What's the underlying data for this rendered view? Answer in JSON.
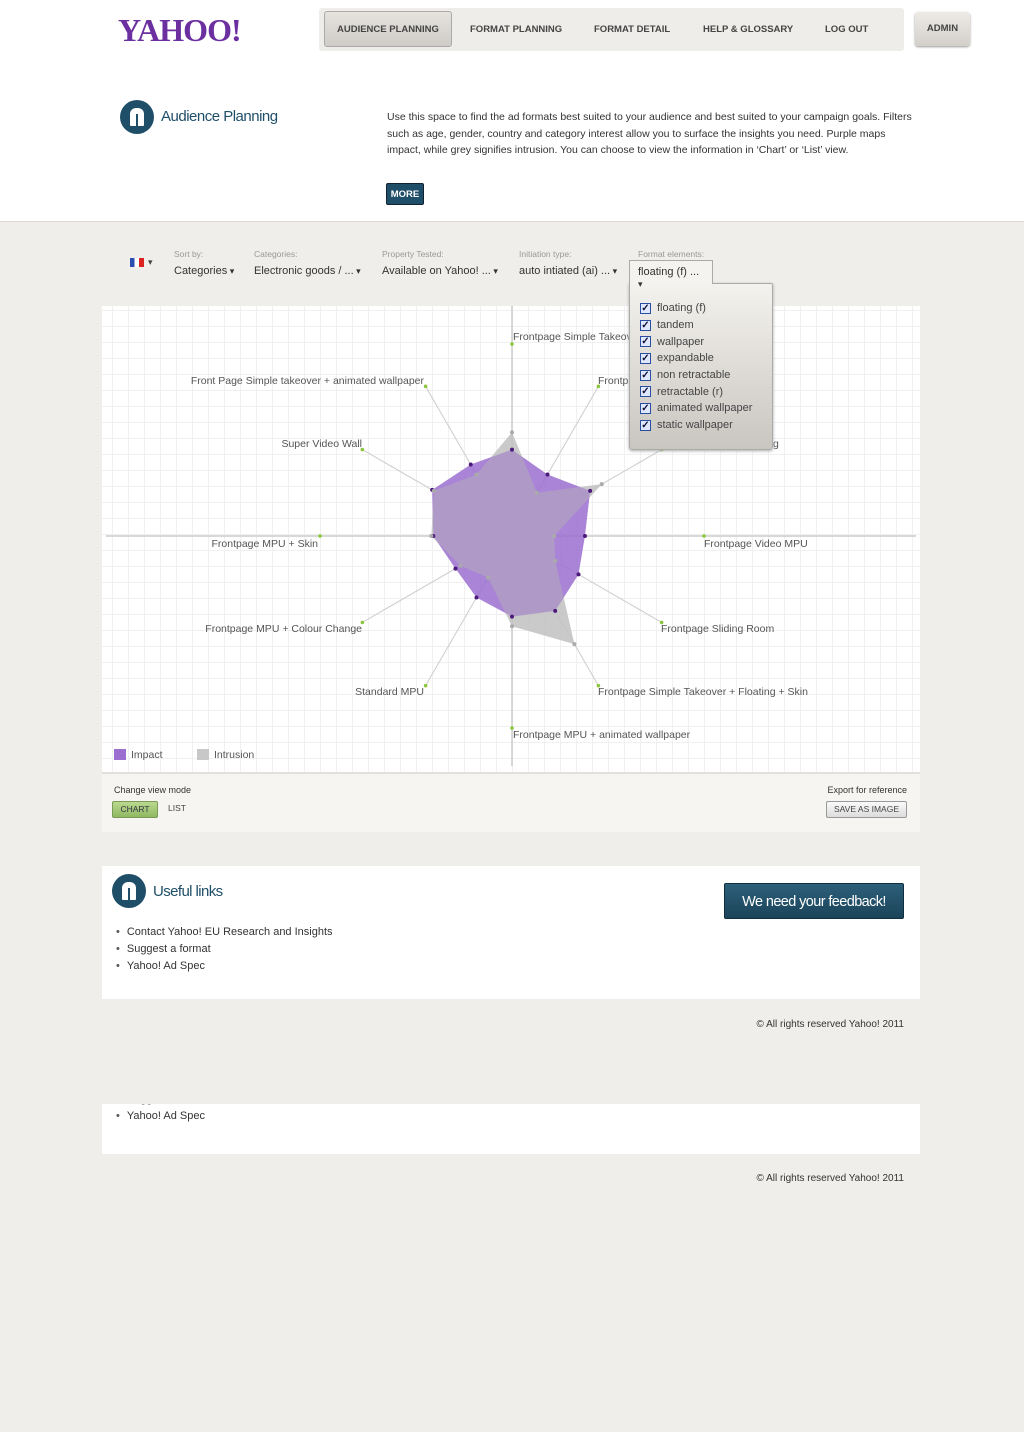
{
  "logo": "YAHOO!",
  "nav": {
    "items": [
      "AUDIENCE PLANNING",
      "FORMAT PLANNING",
      "FORMAT DETAIL",
      "HELP & GLOSSARY",
      "LOG OUT"
    ],
    "admin": "ADMIN"
  },
  "intro": {
    "title": "Audience Planning",
    "text": "Use this space to find the ad formats best suited to your audience and best suited to your campaign goals. Filters such as age, gender, country and category interest allow you to surface the insights you need. Purple maps impact, while grey signifies intrusion. You can choose to view the information in ‘Chart’ or ‘List’ view.",
    "more": "MORE"
  },
  "filters": [
    {
      "label": "Sort by:",
      "value": "Categories"
    },
    {
      "label": "Categories:",
      "value": "Electronic goods / ..."
    },
    {
      "label": "Property Tested:",
      "value": "Available on Yahoo! ..."
    },
    {
      "label": "Initiation type:",
      "value": "auto intiated (ai) ..."
    },
    {
      "label": "Format elements:",
      "value": "floating (f) ..."
    }
  ],
  "format_options": [
    "floating (f)",
    "tandem",
    "wallpaper",
    "expandable",
    "non retractable",
    "retractable (r)",
    "animated wallpaper",
    "static wallpaper"
  ],
  "chart_data": {
    "type": "radar",
    "categories": [
      "Frontpage Simple Takeov",
      "Frontpa",
      "g",
      "Frontpage Video MPU",
      "Frontpage Sliding Room",
      "Frontpage Simple Takeover + Floating + Skin",
      "Frontpage MPU + animated wallpaper",
      "Standard MPU",
      "Frontpage MPU + Colour Change",
      "Frontpage MPU + Skin",
      "Super Video Wall",
      "Front Page Simple takeover + animated wallpaper"
    ],
    "range": [
      0,
      1
    ],
    "series": [
      {
        "name": "Impact",
        "color": "#9b6fcf",
        "values": [
          0.45,
          0.37,
          0.47,
          0.38,
          0.4,
          0.45,
          0.42,
          0.37,
          0.34,
          0.41,
          0.48,
          0.43
        ]
      },
      {
        "name": "Intrusion",
        "color": "#c8c8c8",
        "values": [
          0.54,
          0.26,
          0.54,
          0.22,
          0.26,
          0.65,
          0.47,
          0.25,
          0.31,
          0.42,
          0.47,
          0.37
        ]
      }
    ],
    "legend": "bottom-left",
    "grid": true
  },
  "footer_panel": {
    "change_view": "Change view mode",
    "chart": "CHART",
    "list": "LIST",
    "export": "Export for reference",
    "save": "SAVE AS IMAGE"
  },
  "useful": {
    "title": "Useful links",
    "links": [
      "Contact Yahoo! EU Research and Insights",
      "Suggest a format",
      "Yahoo! Ad Spec"
    ],
    "feedback": "We need your feedback!"
  },
  "copyright": "© All rights reserved Yahoo! 2011"
}
